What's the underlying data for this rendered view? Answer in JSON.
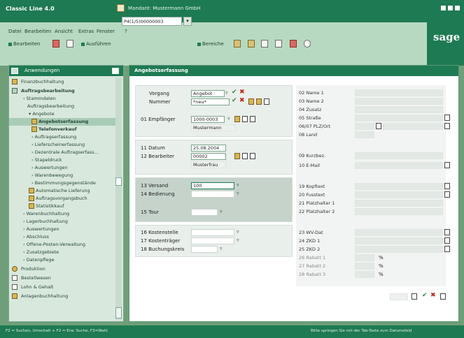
{
  "titlebar": {
    "app_title": "Classic Line 4.0",
    "mandant": "Mandant: Mustermann GmbH"
  },
  "menu": [
    "Datei",
    "Bearbeiten",
    "Ansicht",
    "Extras",
    "Fenster",
    "?"
  ],
  "toolbar": {
    "bearbeiten": "Bearbeiten",
    "ausfuehren": "Ausführen",
    "work_value": "P4(1/5)00000003",
    "bereiche": "Bereiche"
  },
  "sage_logo": "sage",
  "sidebar": {
    "title": "Anwendungen",
    "items": [
      {
        "label": "Finanzbuchhaltung"
      },
      {
        "label": "Auftragsbearbeitung"
      },
      {
        "label": "Stammdaten"
      },
      {
        "label": "Auftragsbearbeitung"
      },
      {
        "label": "Angebote"
      },
      {
        "label": "Angebotserfassung"
      },
      {
        "label": "Telefonverkauf"
      },
      {
        "label": "Auftragserfassung"
      },
      {
        "label": "Lieferscheinerfassung"
      },
      {
        "label": "Dezentrale Auftragserfass..."
      },
      {
        "label": "Stapeldruck"
      },
      {
        "label": "Auswertungen"
      },
      {
        "label": "Warenbewegung"
      },
      {
        "label": "Bestimmungsgegenstände"
      },
      {
        "label": "Automatische Lieferung"
      },
      {
        "label": "Auftragsvorgangsbuch"
      },
      {
        "label": "Statistikkauf"
      },
      {
        "label": "Warenbuchhaltung"
      },
      {
        "label": "Lagerbuchhaltung"
      },
      {
        "label": "Auswertungen"
      },
      {
        "label": "Abschluss"
      },
      {
        "label": "Offene-Posten-Verwaltung"
      },
      {
        "label": "Zusatzgebiete"
      },
      {
        "label": "Datenpflege"
      },
      {
        "label": "Produktion"
      },
      {
        "label": "Bestellwesen"
      },
      {
        "label": "Lohn & Gehalt"
      },
      {
        "label": "Anlagenbuchhaltung"
      }
    ]
  },
  "main": {
    "title": "Angebotserfassung",
    "vorgang_label": "Vorgang",
    "vorgang_value": "Angebot",
    "nummer_label": "Nummer",
    "nummer_value": "*neu*",
    "empfaenger_label": "01 Empfänger",
    "empfaenger_value": "1000-0003",
    "empfaenger_name": "Mustermann",
    "datum_label": "11 Datum",
    "datum_value": "25.08.2004",
    "bearbeiter_label": "12 Bearbeiter",
    "bearbeiter_value": "00002",
    "bearbeiter_name": "Musterfrau",
    "versand_label": "13 Versand",
    "versand_value": "100",
    "bedienung_label": "14 Bedienung",
    "tour_label": "15 Tour",
    "kostenstelle_label": "16 Kostenstelle",
    "kostentraeger_label": "17 Kostenträger",
    "buchungskreis_label": "18 Buchungskreis",
    "right": [
      "02 Name 1",
      "03 Name 2",
      "04 Zusatz",
      "05 Straße",
      "06/07 PLZ/Ort",
      "08 Land",
      "09 Kurzbez.",
      "10 E-Mail",
      "19 Kopftext",
      "20 Fusstext",
      "21 Platzhalter 1",
      "22 Platzhalter 2",
      "23 WV-Dat",
      "24 ZKD 1",
      "25 ZKD 2",
      "26 Rabatt 1",
      "27 Rabatt 2",
      "28 Rabatt 3"
    ],
    "percent": "%"
  },
  "status": {
    "left": "F2 = Suchen, Umschalt + F2 = Erw. Suche, F3=Wahl",
    "right": "Bitte springen Sie mit der Tab-Taste zum Datumsfeld"
  }
}
